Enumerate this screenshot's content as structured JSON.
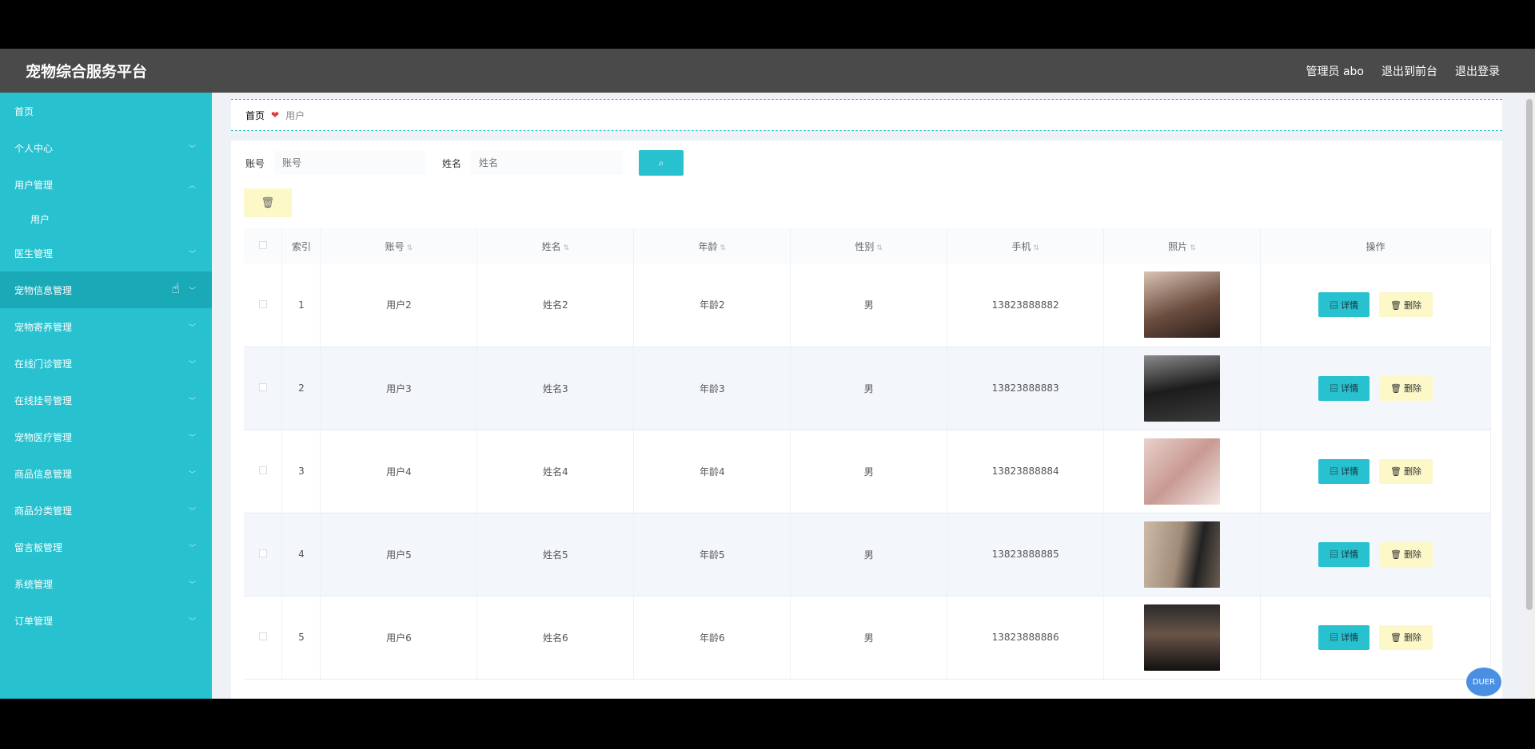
{
  "header": {
    "brand": "宠物综合服务平台",
    "admin": "管理员 abo",
    "front": "退出到前台",
    "logout": "退出登录"
  },
  "sidebar": {
    "items": [
      {
        "label": "首页"
      },
      {
        "label": "个人中心"
      },
      {
        "label": "用户管理"
      },
      {
        "label": "用户"
      },
      {
        "label": "医生管理"
      },
      {
        "label": "宠物信息管理"
      },
      {
        "label": "宠物寄养管理"
      },
      {
        "label": "在线门诊管理"
      },
      {
        "label": "在线挂号管理"
      },
      {
        "label": "宠物医疗管理"
      },
      {
        "label": "商品信息管理"
      },
      {
        "label": "商品分类管理"
      },
      {
        "label": "留言板管理"
      },
      {
        "label": "系统管理"
      },
      {
        "label": "订单管理"
      }
    ]
  },
  "breadcrumb": {
    "home": "首页",
    "current": "用户"
  },
  "search": {
    "account_label": "账号",
    "account_placeholder": "账号",
    "name_label": "姓名",
    "name_placeholder": "姓名"
  },
  "table": {
    "headers": [
      "索引",
      "账号",
      "姓名",
      "年龄",
      "性别",
      "手机",
      "照片",
      "操作"
    ],
    "rows": [
      {
        "index": "1",
        "account": "用户2",
        "name": "姓名2",
        "age": "年龄2",
        "gender": "男",
        "phone": "13823888882"
      },
      {
        "index": "2",
        "account": "用户3",
        "name": "姓名3",
        "age": "年龄3",
        "gender": "男",
        "phone": "13823888883"
      },
      {
        "index": "3",
        "account": "用户4",
        "name": "姓名4",
        "age": "年龄4",
        "gender": "男",
        "phone": "13823888884"
      },
      {
        "index": "4",
        "account": "用户5",
        "name": "姓名5",
        "age": "年龄5",
        "gender": "男",
        "phone": "13823888885"
      },
      {
        "index": "5",
        "account": "用户6",
        "name": "姓名6",
        "age": "年龄6",
        "gender": "男",
        "phone": "13823888886"
      }
    ],
    "detail_label": "详情",
    "delete_label": "删除"
  },
  "badge": {
    "text": "DUER"
  },
  "colors": {
    "accent": "#27c1cf",
    "header": "#4a4a4a",
    "warn": "#fdf8c8"
  }
}
